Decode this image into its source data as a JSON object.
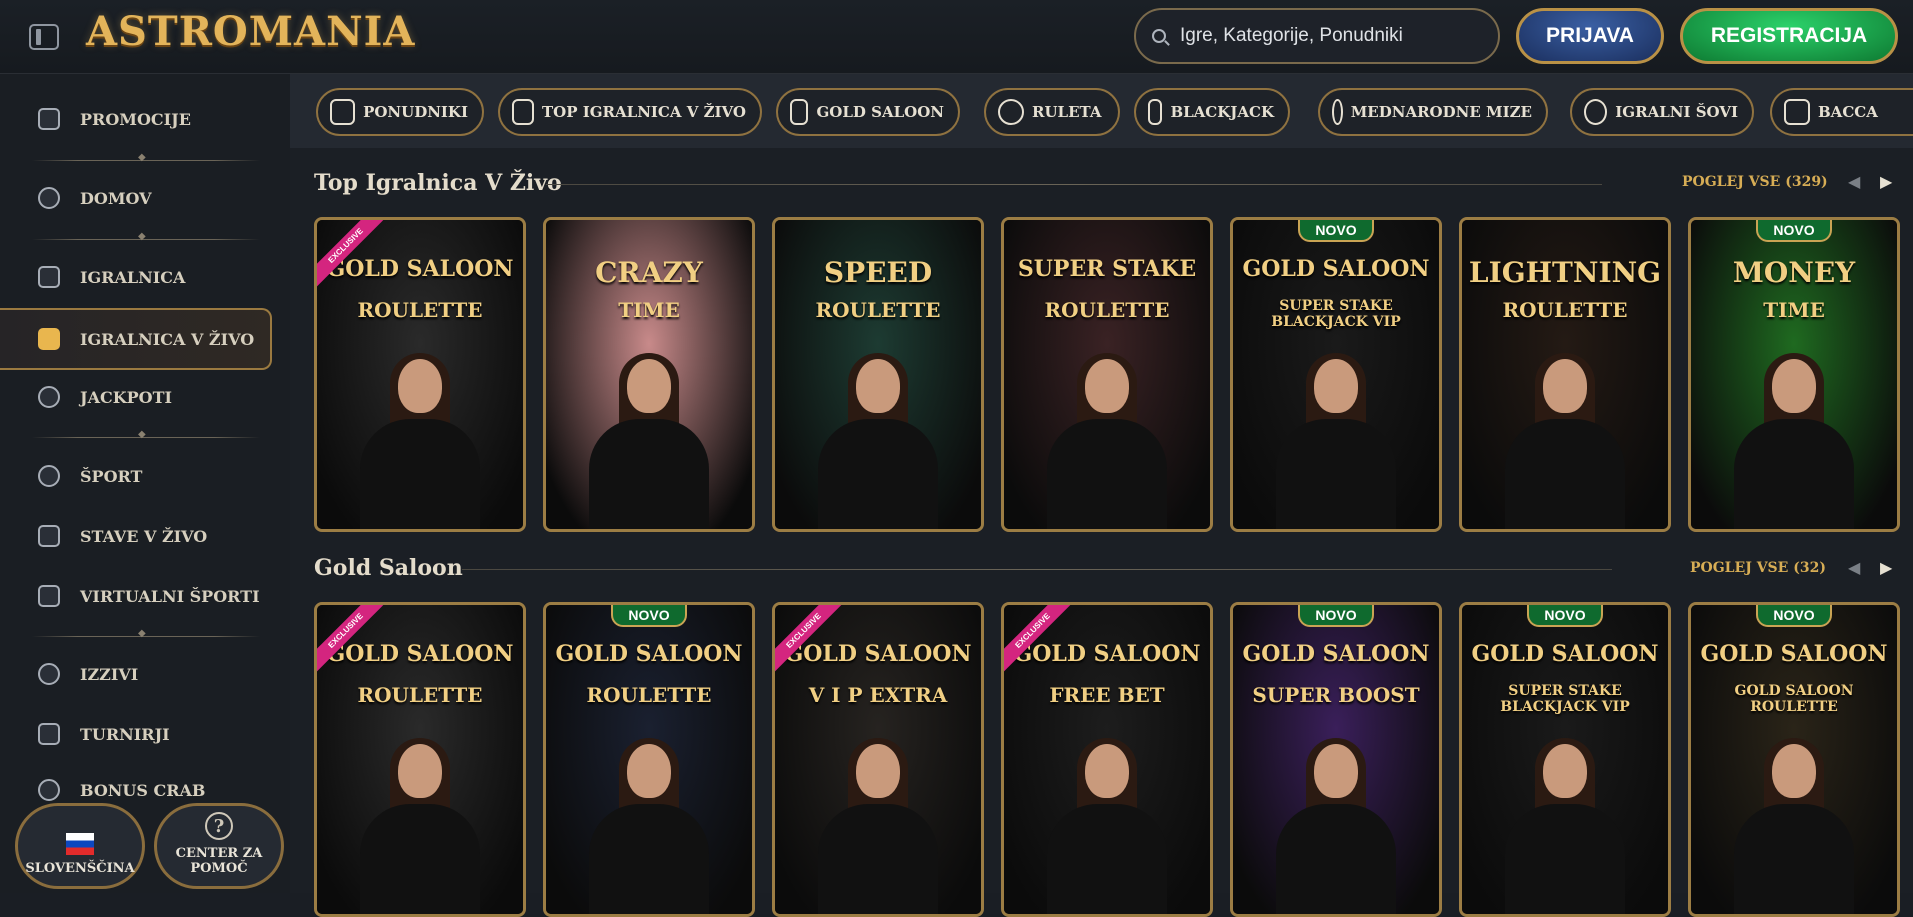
{
  "header": {
    "logo_text": "ASTROMANIA",
    "search_placeholder": "Igre, Kategorije, Ponudniki",
    "login_label": "PRIJAVA",
    "register_label": "REGISTRACIJA"
  },
  "sidebar": {
    "items": [
      {
        "label": "PROMOCIJE"
      },
      {
        "label": "DOMOV"
      },
      {
        "label": "IGRALNICA"
      },
      {
        "label": "IGRALNICA V ŽIVO"
      },
      {
        "label": "JACKPOTI"
      },
      {
        "label": "ŠPORT"
      },
      {
        "label": "STAVE V ŽIVO"
      },
      {
        "label": "VIRTUALNI ŠPORTI"
      },
      {
        "label": "IZZIVI"
      },
      {
        "label": "TURNIRJI"
      },
      {
        "label": "BONUS CRAB"
      }
    ],
    "language_label": "SLOVENŠČINA",
    "help_label": "CENTER ZA POMOČ",
    "help_icon_glyph": "?"
  },
  "categories": [
    {
      "label": "PONUDNIKI",
      "icon": "scroll-icon"
    },
    {
      "label": "TOP IGRALNICA V ŽIVO",
      "icon": "crown-icon"
    },
    {
      "label": "GOLD SALOON",
      "icon": "fleur-icon"
    },
    {
      "label": "RULETA",
      "icon": "roulette-icon"
    },
    {
      "label": "BLACKJACK",
      "icon": "cards-icon"
    },
    {
      "label": "MEDNARODNE MIZE",
      "icon": "globe-icon"
    },
    {
      "label": "IGRALNI ŠOVI",
      "icon": "microphone-icon"
    },
    {
      "label": "BACCA",
      "icon": "baccarat-cards-icon"
    }
  ],
  "sections": [
    {
      "title": "Top Igralnica V Živo",
      "see_all": "POGLEJ VSE (329)",
      "cards": [
        {
          "title": "GOLD SALOON",
          "sub": "ROULETTE",
          "badge": "EXCLUSIVE",
          "bg": "#2a2a2a"
        },
        {
          "title": "CRAZY",
          "sub": "TIME",
          "badge": "",
          "bg": "#c88a8a"
        },
        {
          "title": "SPEED",
          "sub": "ROULETTE",
          "badge": "",
          "bg": "#1d3b32"
        },
        {
          "title": "SUPER STAKE",
          "sub": "ROULETTE",
          "badge": "",
          "bg": "#3a2224"
        },
        {
          "title": "GOLD SALOON",
          "sub": "SUPER STAKE BLACKJACK VIP",
          "badge": "NOVO",
          "bg": "#1a1a1a"
        },
        {
          "title": "LIGHTNING",
          "sub": "ROULETTE",
          "badge": "",
          "bg": "#241a14"
        },
        {
          "title": "MONEY",
          "sub": "TIME",
          "badge": "NOVO",
          "bg": "#1f6a20"
        }
      ]
    },
    {
      "title": "Gold Saloon",
      "see_all": "POGLEJ VSE (32)",
      "cards": [
        {
          "title": "GOLD SALOON",
          "sub": "ROULETTE",
          "badge": "EXCLUSIVE",
          "bg": "#2a2a2a"
        },
        {
          "title": "GOLD SALOON",
          "sub": "ROULETTE",
          "badge": "NOVO",
          "bg": "#1a2030"
        },
        {
          "title": "GOLD SALOON",
          "sub": "V I P EXTRA",
          "badge": "EXCLUSIVE",
          "bg": "#262320"
        },
        {
          "title": "GOLD SALOON",
          "sub": "FREE BET",
          "badge": "EXCLUSIVE",
          "bg": "#1d1d1d"
        },
        {
          "title": "GOLD SALOON",
          "sub": "SUPER BOOST",
          "badge": "NOVO",
          "bg": "#3a1f5a"
        },
        {
          "title": "GOLD SALOON",
          "sub": "SUPER STAKE BLACKJACK VIP",
          "badge": "NOVO",
          "bg": "#1a1a1a"
        },
        {
          "title": "GOLD SALOON",
          "sub": "GOLD SALOON ROULETTE",
          "badge": "NOVO",
          "bg": "#2a2418"
        }
      ]
    }
  ],
  "colors": {
    "accent_gold": "#d7ad55",
    "register_green": "#1aa84b",
    "login_blue": "#2b4b8a",
    "exclusive_pink": "#d4257f"
  }
}
